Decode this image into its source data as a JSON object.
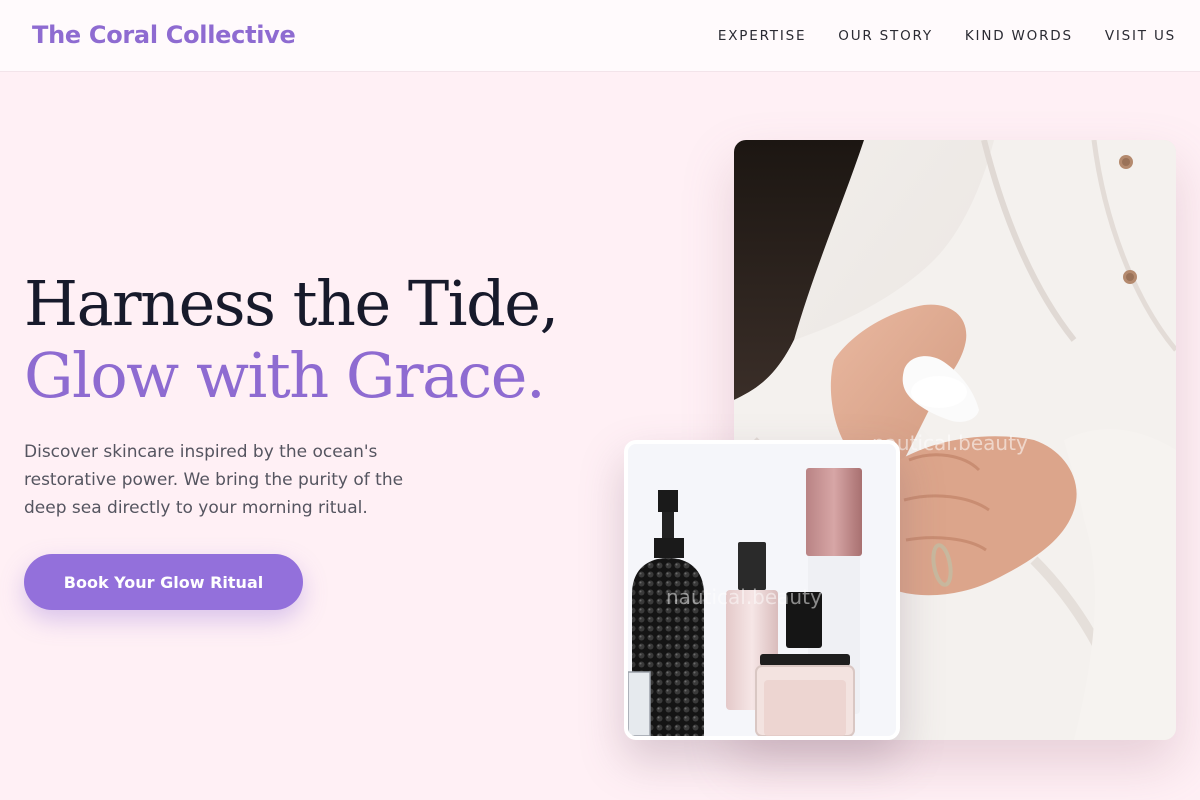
{
  "brand": {
    "name": "The Coral Collective"
  },
  "nav": {
    "items": [
      {
        "label": "EXPERTISE"
      },
      {
        "label": "OUR STORY"
      },
      {
        "label": "KIND WORDS"
      },
      {
        "label": "VISIT US"
      }
    ]
  },
  "hero": {
    "headline_line1": "Harness the Tide,",
    "headline_line2": "Glow with Grace.",
    "description": "Discover skincare inspired by the ocean's restorative power. We bring the purity of the deep sea directly to your morning ritual.",
    "cta_label": "Book Your Glow Ritual"
  },
  "images": {
    "main_watermark": "nautical.beauty",
    "small_watermark": "nautical.beauty"
  },
  "colors": {
    "accent": "#8e6bd1",
    "button": "#9370db",
    "background": "#fff0f5",
    "headline": "#171a2b",
    "body_text": "#555560"
  }
}
